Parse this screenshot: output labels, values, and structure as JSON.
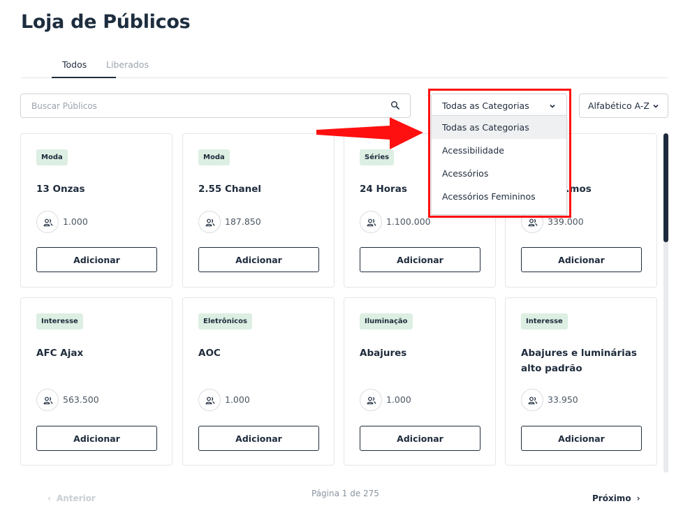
{
  "page": {
    "title": "Loja de Públicos"
  },
  "tabs": [
    {
      "label": "Todos",
      "active": true
    },
    {
      "label": "Liberados",
      "active": false
    }
  ],
  "search": {
    "placeholder": "Buscar Públicos",
    "value": ""
  },
  "filters": {
    "category": {
      "selected": "Todas as Categorias"
    },
    "sort": {
      "selected": "Alfabético A-Z"
    }
  },
  "dropdown": {
    "options": [
      "Todas as Categorias",
      "Acessibilidade",
      "Acessórios",
      "Acessórios Femininos"
    ]
  },
  "cards": [
    {
      "category": "Moda",
      "name": "13 Onzas",
      "audience": "1.000",
      "button": "Adicionar"
    },
    {
      "category": "Moda",
      "name": "2.55 Chanel",
      "audience": "187.850",
      "button": "Adicionar"
    },
    {
      "category": "Séries",
      "name": "24 Horas",
      "audience": "1.100.000",
      "button": "Adicionar"
    },
    {
      "category": "",
      "name": "...mos",
      "audience": "339.000",
      "button": "Adicionar"
    },
    {
      "category": "Interesse",
      "name": "AFC Ajax",
      "audience": "563.500",
      "button": "Adicionar"
    },
    {
      "category": "Eletrônicos",
      "name": "AOC",
      "audience": "1.000",
      "button": "Adicionar"
    },
    {
      "category": "Iluminação",
      "name": "Abajures",
      "audience": "1.000",
      "button": "Adicionar"
    },
    {
      "category": "Interesse",
      "name": "Abajures e luminárias alto padrão",
      "audience": "33.950",
      "button": "Adicionar"
    }
  ],
  "pagination": {
    "prev": "Anterior",
    "info": "Página 1 de 275",
    "next": "Próximo"
  },
  "colors": {
    "accent": "#1e2b3c",
    "badge_bg": "#dcefe2",
    "highlight": "#ff1010"
  }
}
